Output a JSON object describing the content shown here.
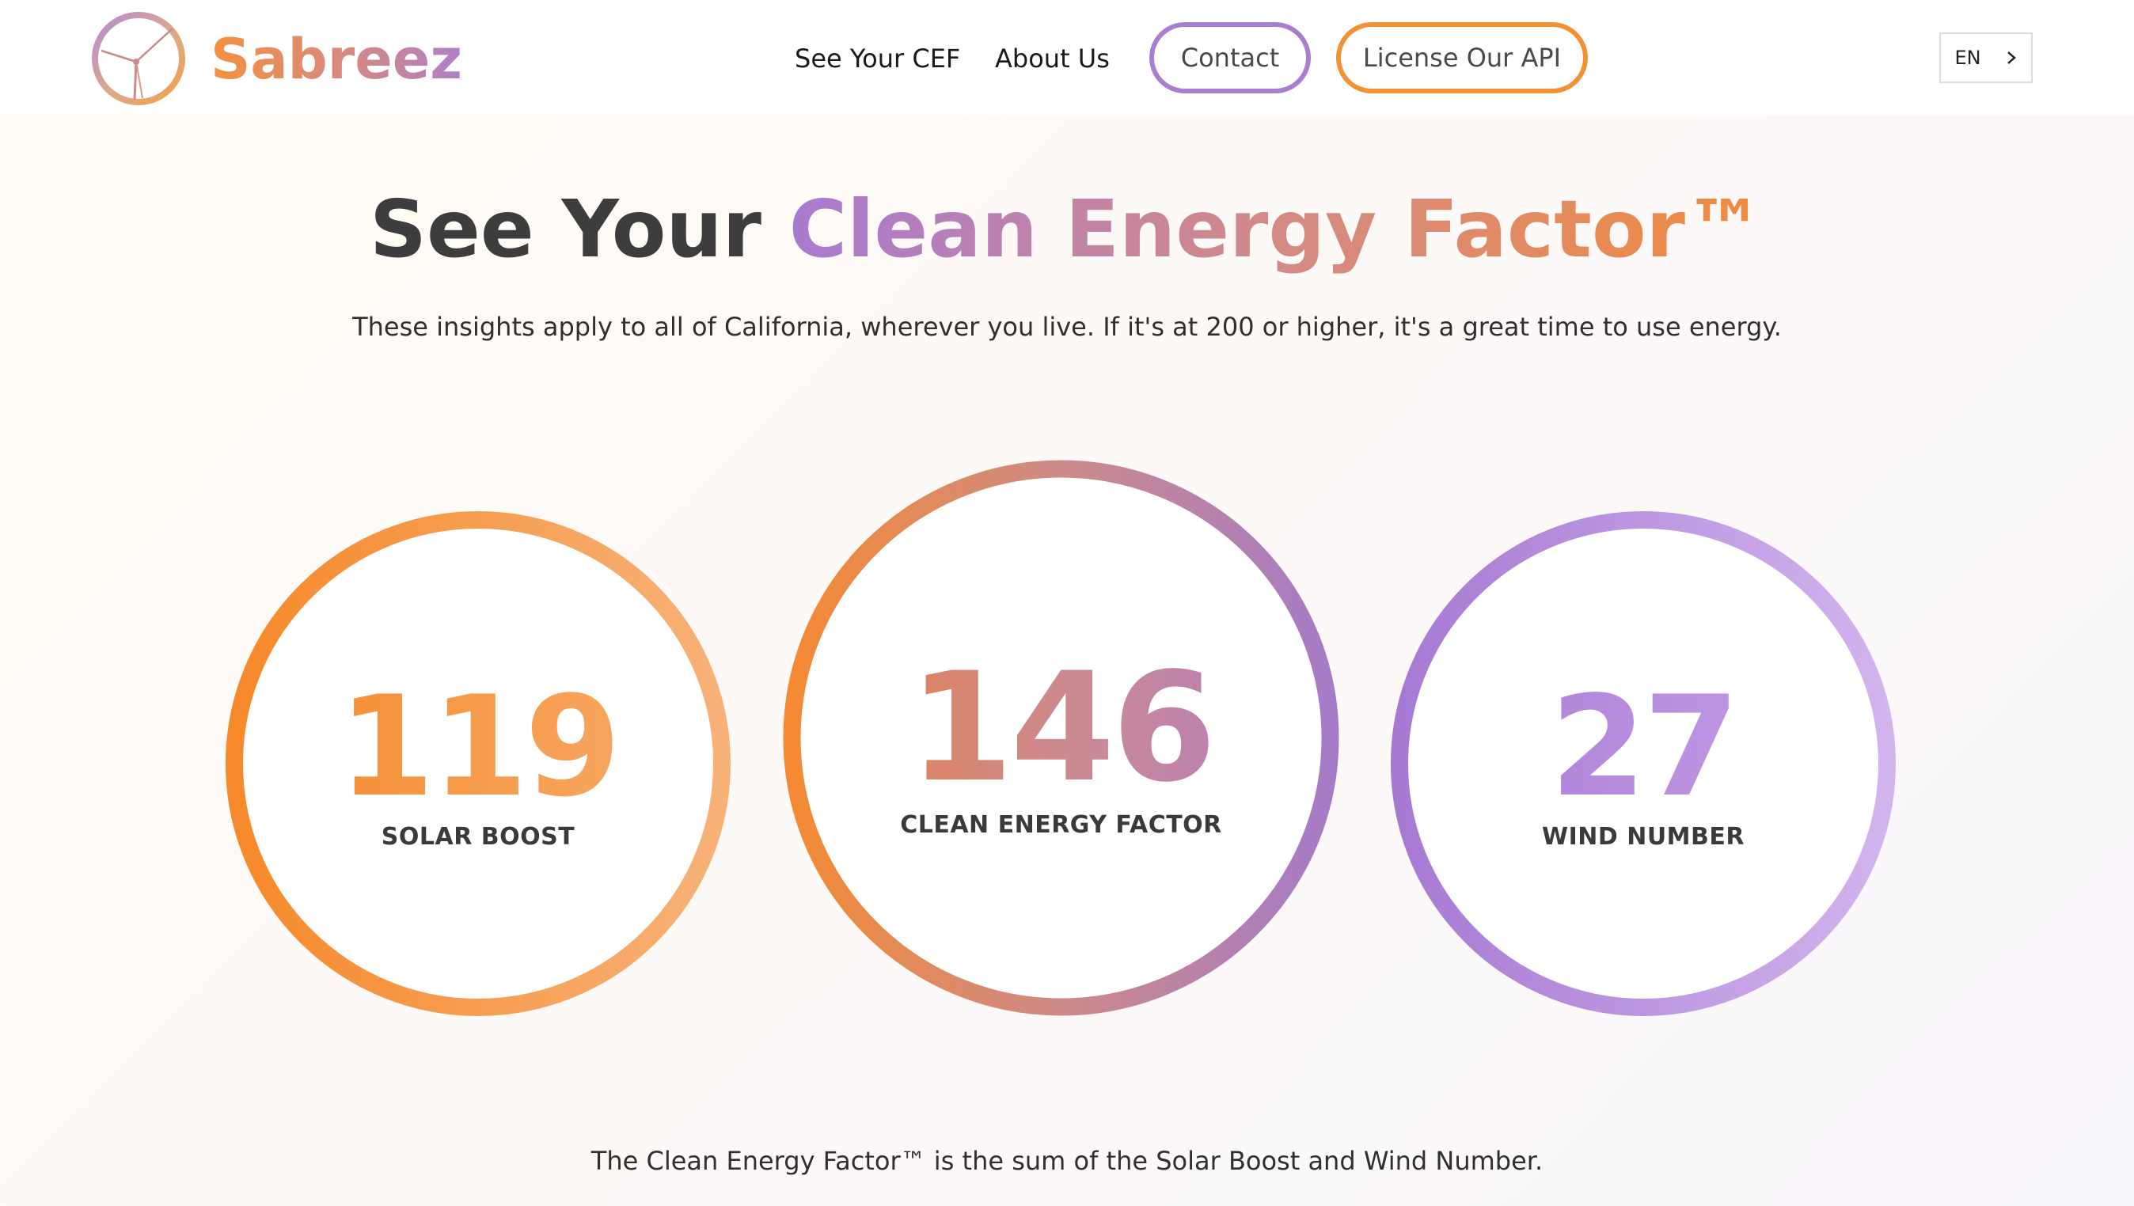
{
  "header": {
    "brand": "Sabreez",
    "logo_icon": "wind-turbine-logo-icon",
    "nav": {
      "see_cef": "See Your CEF",
      "about": "About Us",
      "contact": "Contact",
      "license_api": "License Our API"
    },
    "language": {
      "selected": "EN",
      "icon": "chevron-right-icon"
    }
  },
  "hero": {
    "title_plain": "See Your ",
    "title_highlight": "Clean Energy Factor™",
    "subtitle": "These insights apply to all of California, wherever you live. If it's at 200 or higher, it's a great time to use energy."
  },
  "metrics": {
    "solar": {
      "value": "119",
      "label": "SOLAR BOOST"
    },
    "cef": {
      "value": "146",
      "label": "CLEAN ENERGY FACTOR"
    },
    "wind": {
      "value": "27",
      "label": "WIND NUMBER"
    }
  },
  "footnote": "The Clean Energy Factor™ is the sum of the Solar Boost and Wind Number.",
  "colors": {
    "orange": "#f39234",
    "purple": "#a77fd0",
    "text_dark": "#3d3d3d"
  }
}
